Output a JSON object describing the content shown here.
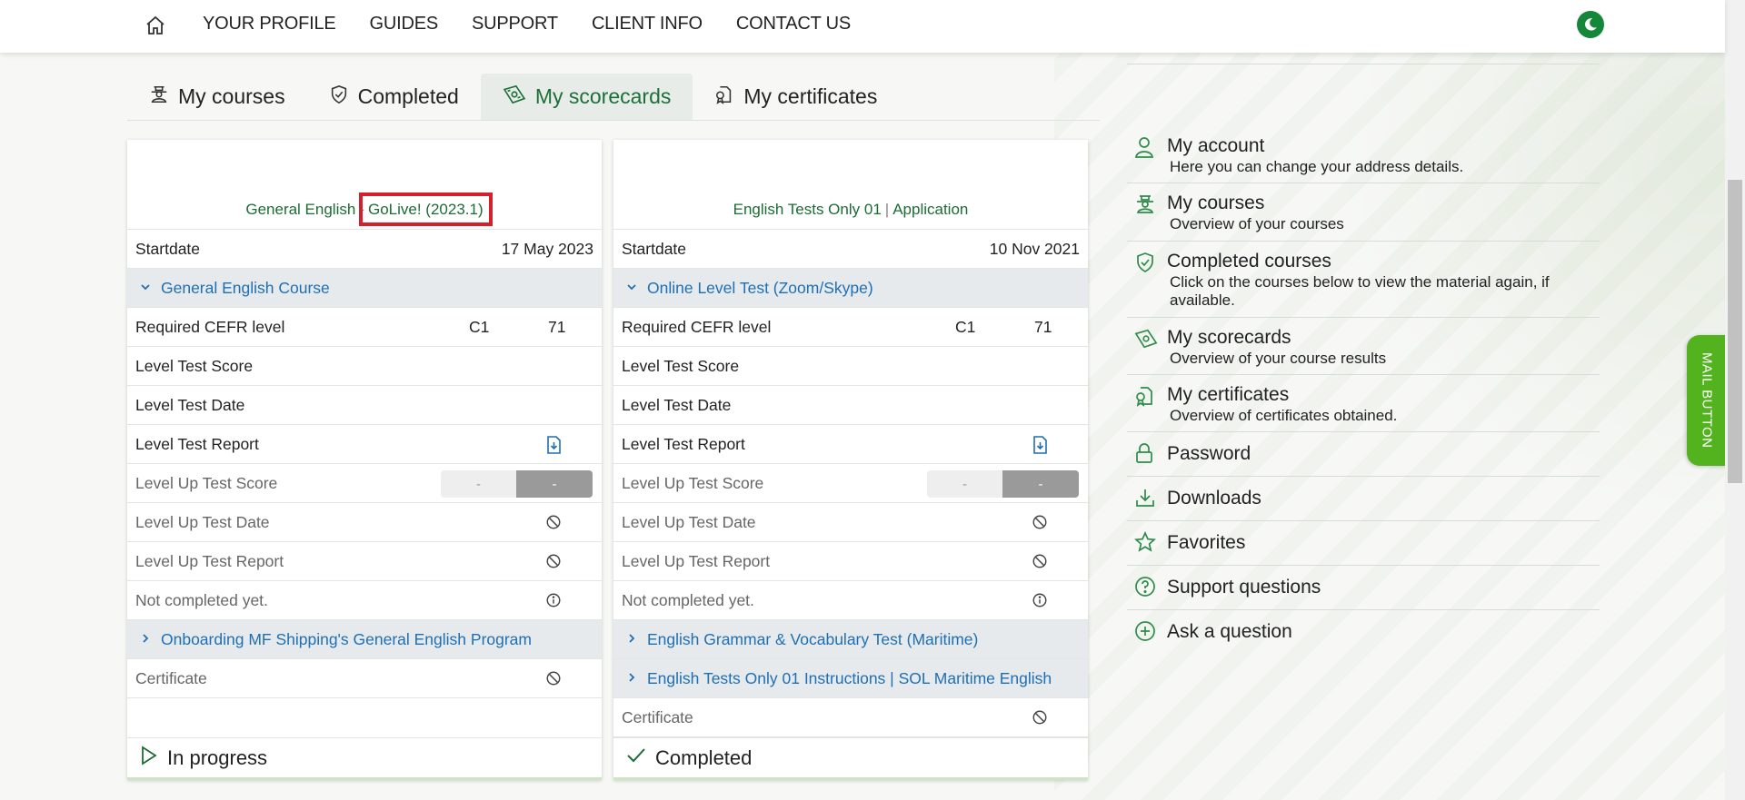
{
  "nav": {
    "links": [
      "YOUR PROFILE",
      "GUIDES",
      "SUPPORT",
      "CLIENT INFO",
      "CONTACT US"
    ],
    "home_icon": "home-icon",
    "theme_icon": "moon-icon",
    "accent": "#14873a"
  },
  "tabs": [
    {
      "label": "My courses",
      "icon": "courses-icon",
      "active": false
    },
    {
      "label": "Completed",
      "icon": "shield-check-icon",
      "active": false
    },
    {
      "label": "My scorecards",
      "icon": "scorecard-icon",
      "active": true
    },
    {
      "label": "My certificates",
      "icon": "certificate-icon",
      "active": false
    }
  ],
  "cards": [
    {
      "title_left": "General English",
      "title_sep": "-",
      "title_right": "GoLive! (2023.1)",
      "startdate_label": "Startdate",
      "startdate": "17 May 2023",
      "section1": "General English Course",
      "cefr_label": "Required CEFR level",
      "cefr_level": "C1",
      "cefr_score": "71",
      "lt_score": "Level Test Score",
      "lt_date": "Level Test Date",
      "lt_report": "Level Test Report",
      "lu_score": "Level Up Test Score",
      "lu_score_a": "-",
      "lu_score_b": "-",
      "lu_date": "Level Up Test Date",
      "lu_report": "Level Up Test Report",
      "not_completed": "Not completed yet.",
      "section2": "Onboarding MF Shipping's General English Program",
      "certificate": "Certificate",
      "status": "In progress"
    },
    {
      "title_left": "English Tests Only 01",
      "title_sep": "|",
      "title_right": "Application",
      "startdate_label": "Startdate",
      "startdate": "10 Nov 2021",
      "section1": "Online Level Test (Zoom/Skype)",
      "cefr_label": "Required CEFR level",
      "cefr_level": "C1",
      "cefr_score": "71",
      "lt_score": "Level Test Score",
      "lt_date": "Level Test Date",
      "lt_report": "Level Test Report",
      "lu_score": "Level Up Test Score",
      "lu_score_a": "-",
      "lu_score_b": "-",
      "lu_date": "Level Up Test Date",
      "lu_report": "Level Up Test Report",
      "not_completed": "Not completed yet.",
      "section2": "English Grammar & Vocabulary Test (Maritime)",
      "section3": "English Tests Only 01 Instructions | SOL Maritime English",
      "certificate": "Certificate",
      "status": "Completed"
    }
  ],
  "sidebar": [
    {
      "title": "My account",
      "desc": "Here you can change your address details.",
      "icon": "user-icon"
    },
    {
      "title": "My courses",
      "desc": "Overview of your courses",
      "icon": "courses-icon"
    },
    {
      "title": "Completed courses",
      "desc": "Click on the courses below to view the material again, if available.",
      "icon": "shield-check-icon"
    },
    {
      "title": "My scorecards",
      "desc": "Overview of your course results",
      "icon": "scorecard-icon"
    },
    {
      "title": "My certificates",
      "desc": "Overview of certificates obtained.",
      "icon": "certificate-icon"
    },
    {
      "title": "Password",
      "icon": "lock-icon"
    },
    {
      "title": "Downloads",
      "icon": "download-icon"
    },
    {
      "title": "Favorites",
      "icon": "star-icon"
    },
    {
      "title": "Support questions",
      "icon": "question-icon"
    },
    {
      "title": "Ask a question",
      "icon": "plus-circle-icon"
    }
  ],
  "mail_button": "MAIL BUTTON",
  "colors": {
    "green": "#1d6b35",
    "link_blue": "#1f6fb5",
    "mail_green": "#52b31f",
    "highlight_red": "#d4202a"
  }
}
